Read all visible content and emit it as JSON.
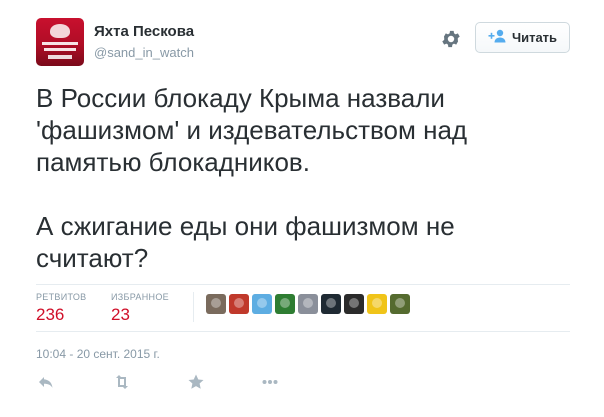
{
  "user": {
    "name": "Яхта Пескова",
    "handle": "@sand_in_watch"
  },
  "follow_button": {
    "label": "Читать"
  },
  "tweet": {
    "text": "В России блокаду Крыма назвали\n'фашизмом' и издевательством над\nпамятью блокадников.\n\nА сжигание еды они фашизмом не\nсчитают?"
  },
  "stats": {
    "retweets_label": "РЕТВИТОВ",
    "retweets_count": "236",
    "favorites_label": "ИЗБРАННОЕ",
    "favorites_count": "23"
  },
  "favoriter_avatar_colors": [
    "#7a6b5d",
    "#c0392b",
    "#5dade2",
    "#2e7d32",
    "#8a8f9a",
    "#1f2a33",
    "#2b2b2b",
    "#f0c419",
    "#556b2f"
  ],
  "timestamp": "10:04 - 20 сент. 2015 г.",
  "colors": {
    "accent": "#d00f29",
    "muted": "#8899a6",
    "text": "#292f33",
    "follow_icon": "#55acee"
  },
  "icons": {
    "settings": "gear-icon",
    "follow": "add-person-icon",
    "reply": "reply-icon",
    "retweet": "retweet-icon",
    "favorite": "star-icon",
    "more": "more-icon"
  }
}
